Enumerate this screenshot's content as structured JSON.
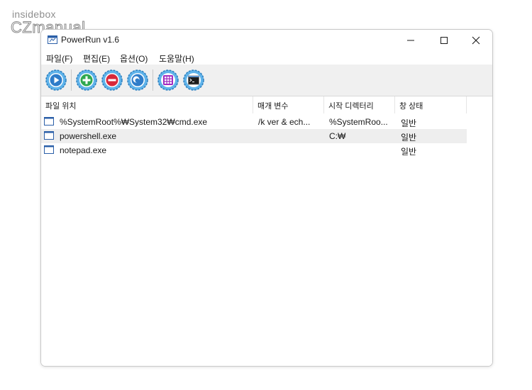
{
  "watermark": {
    "top": "insidebox",
    "bottom": "CZmanual"
  },
  "window": {
    "title": "PowerRun v1.6",
    "menu": [
      "파일(F)",
      "편집(E)",
      "옵션(O)",
      "도움말(H)"
    ],
    "toolbar": [
      {
        "icon": "play-icon"
      },
      {
        "icon": "add-icon"
      },
      {
        "icon": "remove-icon"
      },
      {
        "icon": "edit-icon"
      },
      {
        "icon": "grid-icon"
      },
      {
        "icon": "console-icon"
      }
    ],
    "columns": [
      "파일 위치",
      "매개 변수",
      "시작 디렉터리",
      "창 상태"
    ],
    "rows": [
      {
        "path": "%SystemRoot%₩System32₩cmd.exe",
        "params": "/k ver & ech...",
        "startdir": "%SystemRoo...",
        "state": "일반"
      },
      {
        "path": "powershell.exe",
        "params": "",
        "startdir": "C:₩",
        "state": "일반"
      },
      {
        "path": "notepad.exe",
        "params": "",
        "startdir": "",
        "state": "일반"
      }
    ]
  },
  "colors": {
    "toolbar_icon_blue": "#3a8fd0",
    "toolbar_icon_green": "#2fa84f",
    "toolbar_icon_red": "#d8283a",
    "toolbar_icon_purple": "#a22ec0",
    "selected_row": "#eeeeee",
    "row_icon_blue": "#2b5fa8"
  }
}
